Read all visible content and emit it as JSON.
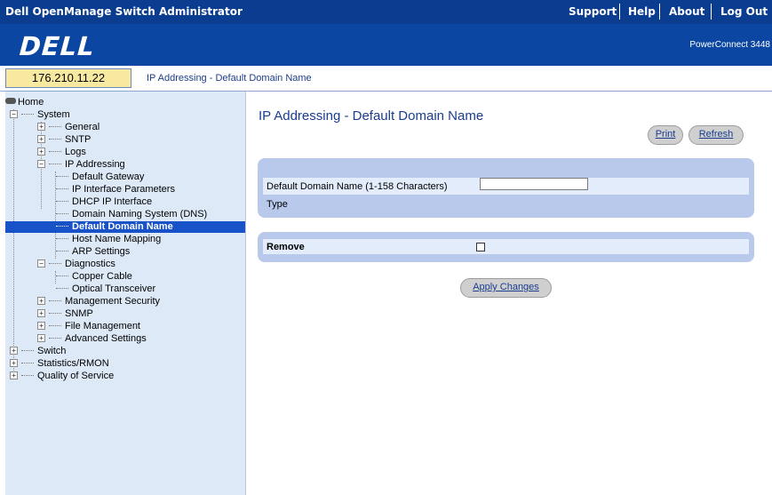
{
  "header": {
    "app_title": "Dell OpenManage Switch Administrator",
    "links": [
      "Support",
      "Help",
      "About",
      "Log Out"
    ]
  },
  "brand": {
    "logo_text": "DELL",
    "model": "PowerConnect 3448"
  },
  "address": {
    "ip": "176.210.11.22",
    "breadcrumb": "IP Addressing - Default Domain Name"
  },
  "tree": {
    "home": "Home",
    "system": "System",
    "general": "General",
    "sntp": "SNTP",
    "logs": "Logs",
    "ip_addressing": "IP Addressing",
    "default_gateway": "Default Gateway",
    "ip_interface_parameters": "IP Interface Parameters",
    "dhcp_ip_interface": "DHCP IP Interface",
    "dns": "Domain Naming System (DNS)",
    "default_domain_name": "Default Domain Name",
    "host_name_mapping": "Host Name Mapping",
    "arp_settings": "ARP Settings",
    "diagnostics": "Diagnostics",
    "copper_cable": "Copper Cable",
    "optical_transceiver": "Optical Transceiver",
    "management_security": "Management Security",
    "snmp": "SNMP",
    "file_management": "File Management",
    "advanced_settings": "Advanced Settings",
    "switch": "Switch",
    "statistics_rmon": "Statistics/RMON",
    "quality_of_service": "Quality of Service"
  },
  "main": {
    "title": "IP Addressing - Default Domain Name",
    "print_label": "Print",
    "refresh_label": "Refresh",
    "domain_name_label": "Default Domain Name (1-158 Characters)",
    "domain_name_value": "",
    "type_label": "Type",
    "remove_label": "Remove",
    "remove_checked": false,
    "apply_label": "Apply Changes"
  },
  "colors": {
    "header_bg": "#0a3d8f",
    "brand_bg": "#0b46a2",
    "nav_bg": "#dde9f7",
    "selected_bg": "#1752c8",
    "panel_bg": "#b9c9ec",
    "ip_box_bg": "#f8e9a1",
    "title_color": "#1a3d91"
  }
}
